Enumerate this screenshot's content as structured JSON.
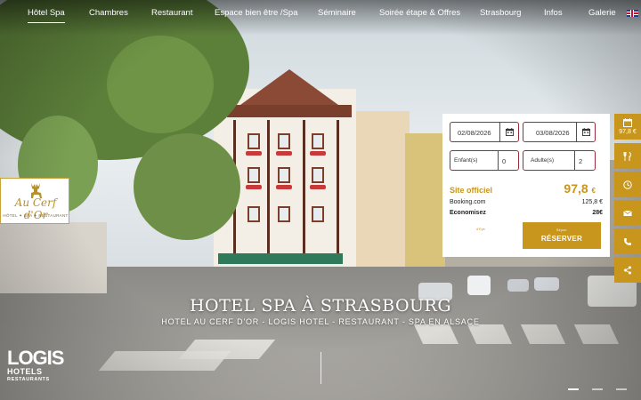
{
  "nav": {
    "items": [
      "Hôtel Spa",
      "Chambres",
      "Restaurant",
      "Espace bien être /Spa",
      "Séminaire",
      "Soirée étape & Offres",
      "Strasbourg",
      "Infos",
      "Galerie"
    ],
    "active": "Hôtel Spa"
  },
  "brand": {
    "script": "Au Cerf d'Or",
    "tagline": "HÔTEL ✦ SPA ✦ RESTAURANT",
    "partner_line1": "LOGIS",
    "partner_line2": "HOTELS",
    "partner_line3": "RESTAURANTS"
  },
  "hero": {
    "title": "HOTEL SPA À STRASBOURG",
    "subtitle": "HOTEL AU CERF D'OR - LOGIS HOTEL - RESTAURANT - SPA EN ALSACE",
    "slides": 3,
    "active_slide": 0
  },
  "booking": {
    "checkin": "02/08/2026",
    "checkout": "03/08/2026",
    "children_label": "Enfant(s)",
    "children_value": "0",
    "adults_label": "Adulte(s)",
    "adults_value": "2",
    "official_label": "Site officiel",
    "official_price": "97,8",
    "currency": "€",
    "booking_label": "Booking.com",
    "booking_price": "125,8 €",
    "savings_label": "Economisez",
    "savings_value": "28€",
    "small_note": "d'Eye",
    "reserve_small": "Séjour",
    "reserve_label": "RÉSERVER"
  },
  "rail": {
    "price": "97,8 €",
    "icons": [
      "calendar-icon",
      "restaurant-icon",
      "clock-icon",
      "mail-icon",
      "phone-icon",
      "share-icon"
    ]
  },
  "colors": {
    "accent": "#c8961c",
    "border": "#9b2a3a"
  }
}
